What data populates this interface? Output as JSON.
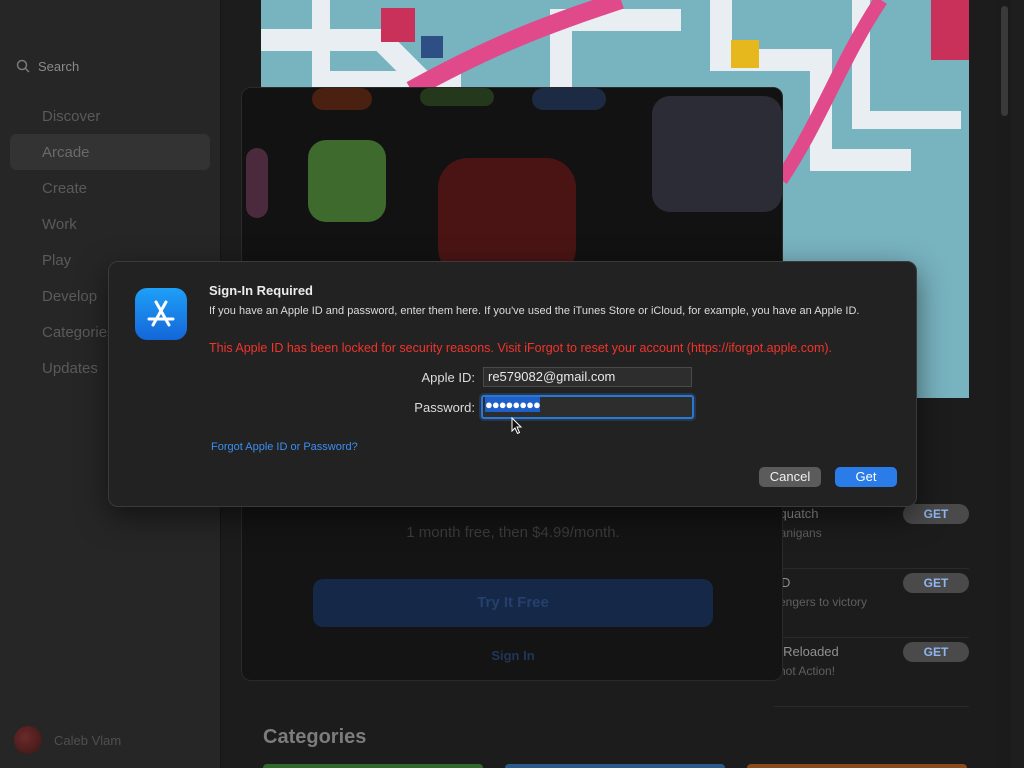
{
  "sidebar": {
    "search_placeholder": "Search",
    "items": [
      {
        "label": "Discover"
      },
      {
        "label": "Arcade"
      },
      {
        "label": "Create"
      },
      {
        "label": "Work"
      },
      {
        "label": "Play"
      },
      {
        "label": "Develop"
      },
      {
        "label": "Categories"
      },
      {
        "label": "Updates"
      }
    ],
    "active_item": "Arcade",
    "user_name": "Caleb Vlam"
  },
  "arcade_sheet": {
    "price_text": "1 month free, then $4.99/month.",
    "try_button": "Try It Free",
    "sign_in_link": "Sign In"
  },
  "side_list": [
    {
      "pre": "",
      "title": "squatch",
      "subtitle": "nanigans",
      "action": "GET"
    },
    {
      "pre": "e",
      "title": "TD",
      "subtitle": "vengers to victory",
      "action": "GET"
    },
    {
      "pre": "e",
      "title": "s Reloaded",
      "subtitle": "shot Action!",
      "action": "GET"
    }
  ],
  "section_title": "Categories",
  "dialog": {
    "title": "Sign-In Required",
    "body": "If you have an Apple ID and password, enter them here. If you've used the iTunes Store or iCloud, for example, you have an Apple ID.",
    "error": "This Apple ID has been locked for security reasons. Visit iForgot to reset your account (https://iforgot.apple.com).",
    "apple_id_label": "Apple ID:",
    "apple_id_value": "re579082@gmail.com",
    "password_label": "Password:",
    "password_value": "●●●●●●●●",
    "forgot_link": "Forgot Apple ID or Password?",
    "cancel_label": "Cancel",
    "get_label": "Get"
  },
  "colors": {
    "accent": "#2a7ce8",
    "error": "#f2342c",
    "link": "#3b8ef0"
  }
}
